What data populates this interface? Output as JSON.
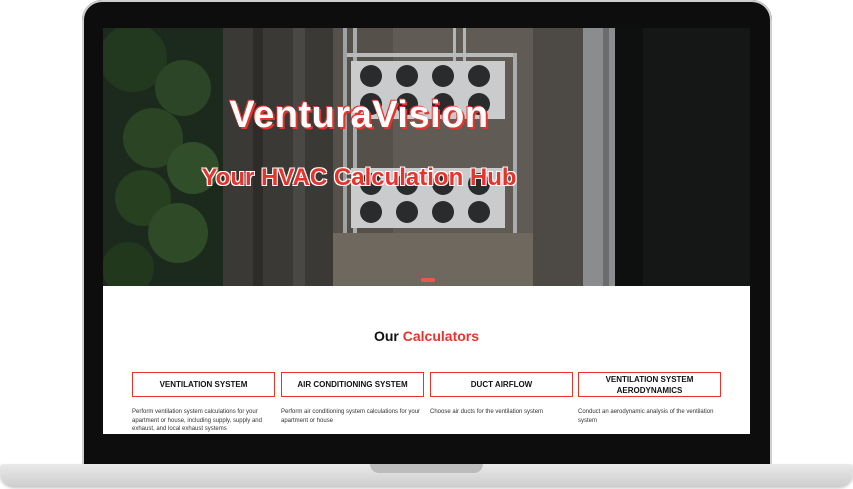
{
  "hero": {
    "title": "VenturaVision",
    "subtitle": "Your HVAC Calculation Hub"
  },
  "calculators_section": {
    "heading_plain": "Our",
    "heading_accent": "Calculators",
    "cards": [
      {
        "label": "VENTILATION SYSTEM",
        "description": "Perform ventilation system calculations for your apartment or house, including supply, supply and exhaust, and local exhaust systems"
      },
      {
        "label": "AIR CONDITIONING SYSTEM",
        "description": "Perform air conditioning system calculations for your apartment or house"
      },
      {
        "label": "DUCT AIRFLOW",
        "description": "Choose air ducts for the ventilation system"
      },
      {
        "label": "VENTILATION SYSTEM AERODYNAMICS",
        "description": "Conduct an aerodynamic analysis of the ventilation system"
      }
    ]
  },
  "colors": {
    "accent": "#e8332b",
    "device_frame": "#0d0d0d"
  }
}
